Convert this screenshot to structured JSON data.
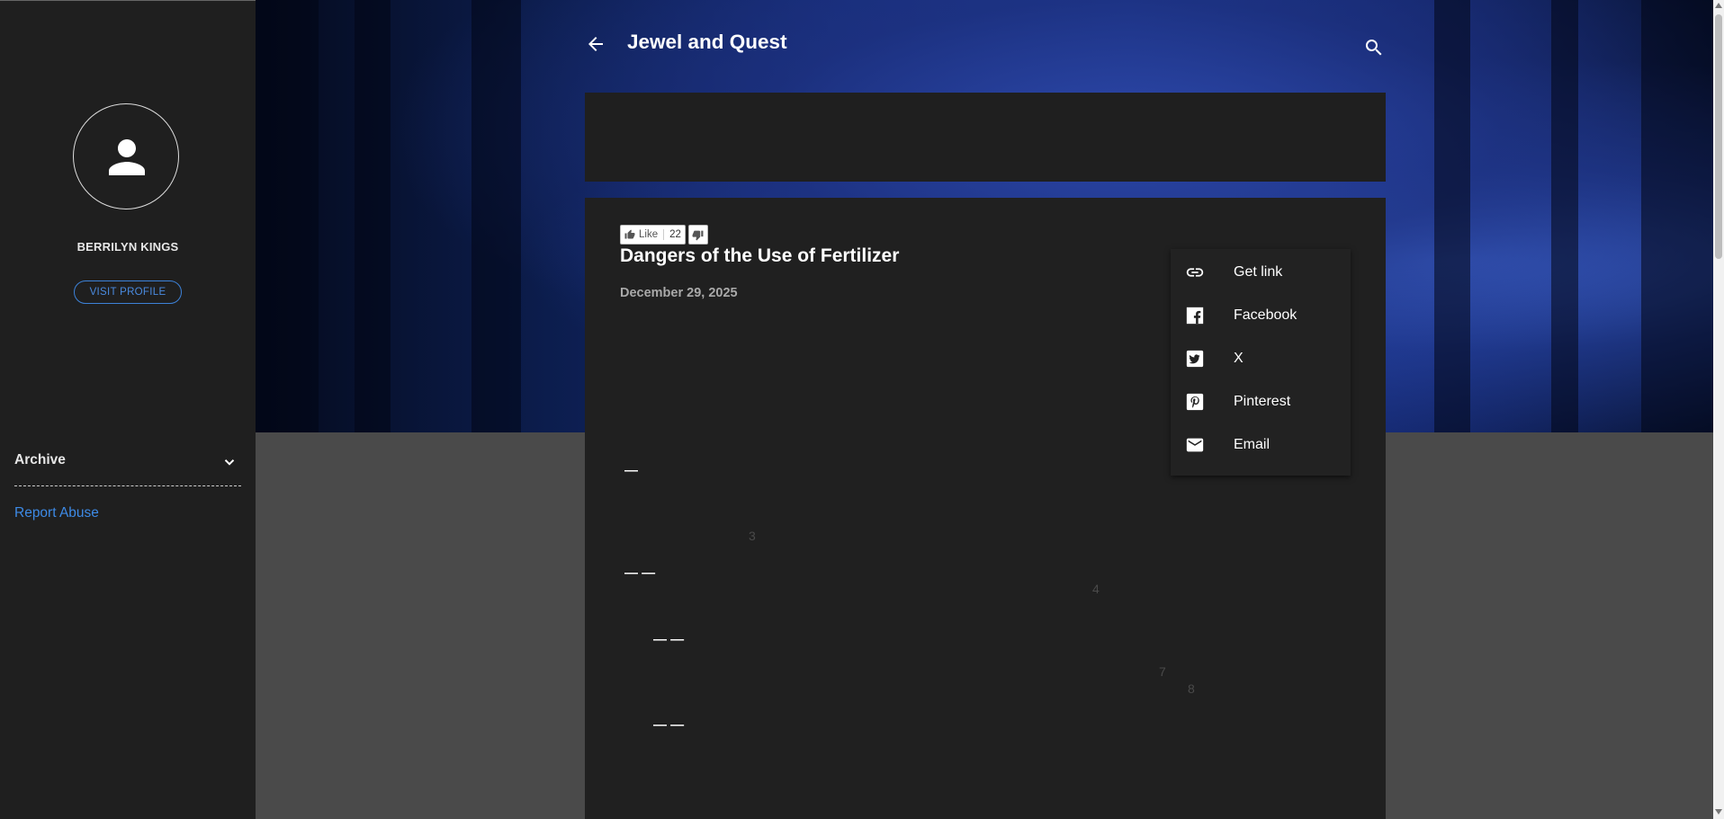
{
  "profile": {
    "name": "BERRILYN KINGS",
    "visit_label": "VISIT PROFILE"
  },
  "sidebar": {
    "archive_label": "Archive",
    "report_label": "Report Abuse"
  },
  "header": {
    "title": "Jewel and Quest"
  },
  "post": {
    "like_label": "Like",
    "like_count": "22",
    "title": "Dangers of the Use of Fertilizer",
    "date": "December 29, 2025",
    "footnote_numbers": [
      "3",
      "4",
      "7",
      "8"
    ]
  },
  "share_menu": {
    "items": [
      {
        "label": "Get link",
        "icon": "link-icon"
      },
      {
        "label": "Facebook",
        "icon": "facebook-icon"
      },
      {
        "label": "X",
        "icon": "x-icon"
      },
      {
        "label": "Pinterest",
        "icon": "pinterest-icon"
      },
      {
        "label": "Email",
        "icon": "email-icon"
      }
    ]
  },
  "colors": {
    "sidebar_bg": "#1f1f1f",
    "post_bg": "#202020",
    "accent_blue": "#3d8ae6",
    "page_bg": "#4a4a4a"
  }
}
